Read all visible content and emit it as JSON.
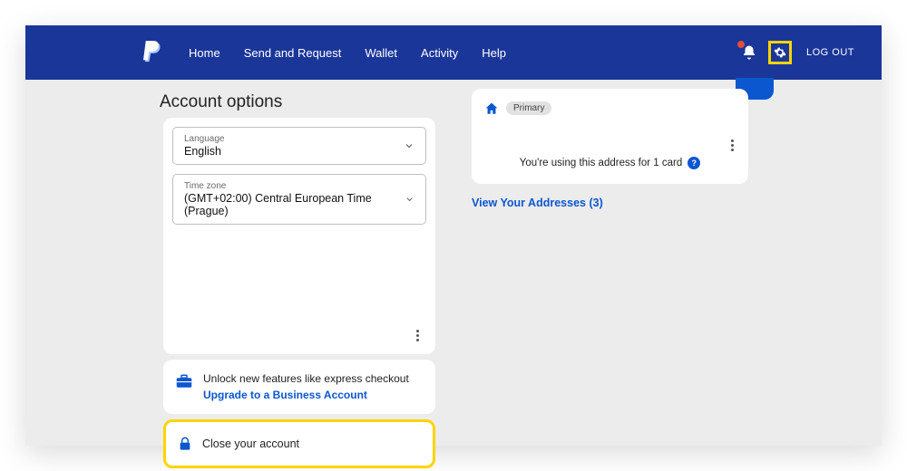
{
  "header": {
    "nav": {
      "home": "Home",
      "send": "Send and Request",
      "wallet": "Wallet",
      "activity": "Activity",
      "help": "Help"
    },
    "logout": "LOG OUT"
  },
  "section_title": "Account options",
  "language_dropdown": {
    "label": "Language",
    "value": "English"
  },
  "timezone_dropdown": {
    "label": "Time zone",
    "value": "(GMT+02:00) Central European Time (Prague)"
  },
  "upgrade": {
    "text": "Unlock new features like express checkout",
    "link": "Upgrade to a Business Account"
  },
  "close_account": "Close your account",
  "address": {
    "badge": "Primary",
    "note": "You're using this address for 1 card",
    "view_link": "View Your Addresses (3)"
  },
  "colors": {
    "brand_blue": "#1a3699",
    "link_blue": "#0b57d0",
    "highlight_yellow": "#ffd400"
  }
}
